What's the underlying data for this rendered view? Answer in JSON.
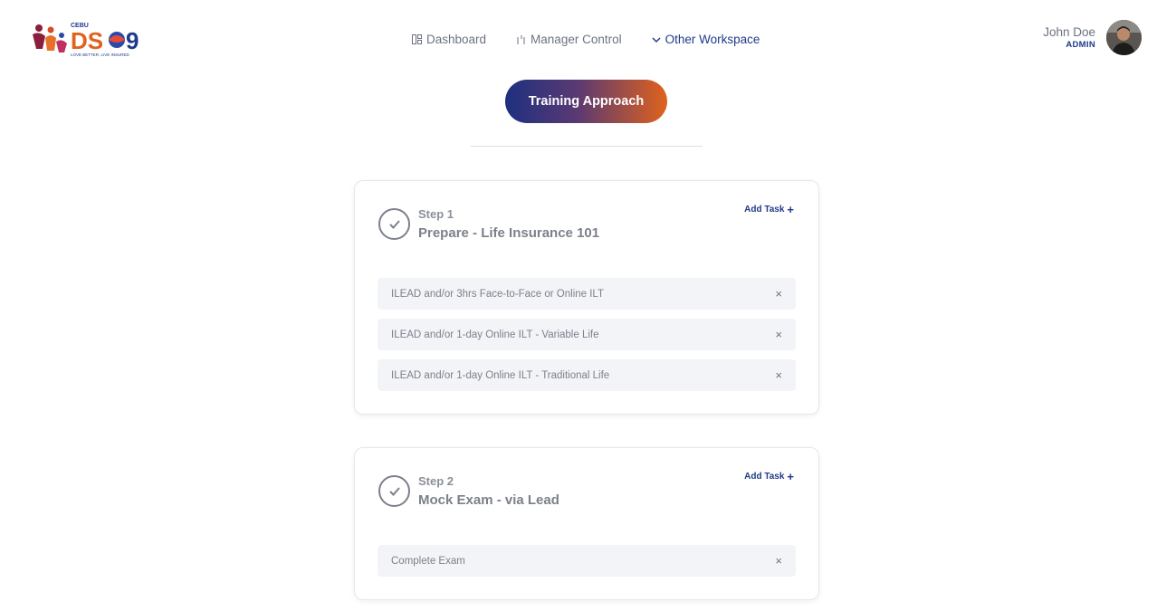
{
  "logo": {
    "top_text": "CEBU",
    "brand_left": "DS",
    "brand_right": "9",
    "tagline": "LOVE BETTER. LIVE INSURED"
  },
  "nav": {
    "items": [
      {
        "label": "Dashboard",
        "icon": "dashboard-icon"
      },
      {
        "label": "Manager Control",
        "icon": "manager-control-icon"
      },
      {
        "label": "Other Workspace",
        "icon": "chevron-down-icon"
      }
    ]
  },
  "user": {
    "name": "John Doe",
    "role": "ADMIN"
  },
  "page": {
    "title": "Training Approach"
  },
  "steps": [
    {
      "label": "Step 1",
      "title": "Prepare - Life Insurance 101",
      "add_task_label": "Add Task",
      "tasks": [
        "ILEAD and/or 3hrs Face-to-Face or Online ILT",
        "ILEAD and/or 1-day Online ILT - Variable Life",
        "ILEAD and/or 1-day Online ILT - Traditional Life"
      ]
    },
    {
      "label": "Step 2",
      "title": "Mock Exam - via Lead",
      "add_task_label": "Add Task",
      "tasks": [
        "Complete Exam"
      ]
    }
  ],
  "colors": {
    "accent": "#1f3a8a",
    "gradient_start": "#1e2f80",
    "gradient_end": "#e0621c"
  },
  "icons": {
    "remove": "×",
    "add": "+"
  }
}
